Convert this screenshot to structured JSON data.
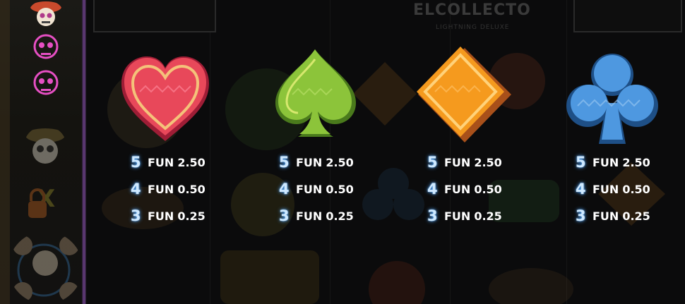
{
  "game": {
    "logo_text": "ELCOLLECTO",
    "logo_subtitle": "LIGHTNING DELUXE"
  },
  "paytable": [
    {
      "suit": "heart-icon",
      "color": "#e8485a",
      "rows": [
        {
          "count": "5",
          "currency": "FUN",
          "value": "2.50"
        },
        {
          "count": "4",
          "currency": "FUN",
          "value": "0.50"
        },
        {
          "count": "3",
          "currency": "FUN",
          "value": "0.25"
        }
      ]
    },
    {
      "suit": "spade-icon",
      "color": "#8cc43a",
      "rows": [
        {
          "count": "5",
          "currency": "FUN",
          "value": "2.50"
        },
        {
          "count": "4",
          "currency": "FUN",
          "value": "0.50"
        },
        {
          "count": "3",
          "currency": "FUN",
          "value": "0.25"
        }
      ]
    },
    {
      "suit": "diamond-icon",
      "color": "#f59a1e",
      "rows": [
        {
          "count": "5",
          "currency": "FUN",
          "value": "2.50"
        },
        {
          "count": "4",
          "currency": "FUN",
          "value": "0.50"
        },
        {
          "count": "3",
          "currency": "FUN",
          "value": "0.25"
        }
      ]
    },
    {
      "suit": "club-icon",
      "color": "#4e98e0",
      "rows": [
        {
          "count": "5",
          "currency": "FUN",
          "value": "2.50"
        },
        {
          "count": "4",
          "currency": "FUN",
          "value": "0.50"
        },
        {
          "count": "3",
          "currency": "FUN",
          "value": "0.25"
        }
      ]
    }
  ],
  "colors": {
    "count_glow": "#4aa3ff",
    "value_text": "#ffffff",
    "strip_divider": "#6a3f86"
  }
}
